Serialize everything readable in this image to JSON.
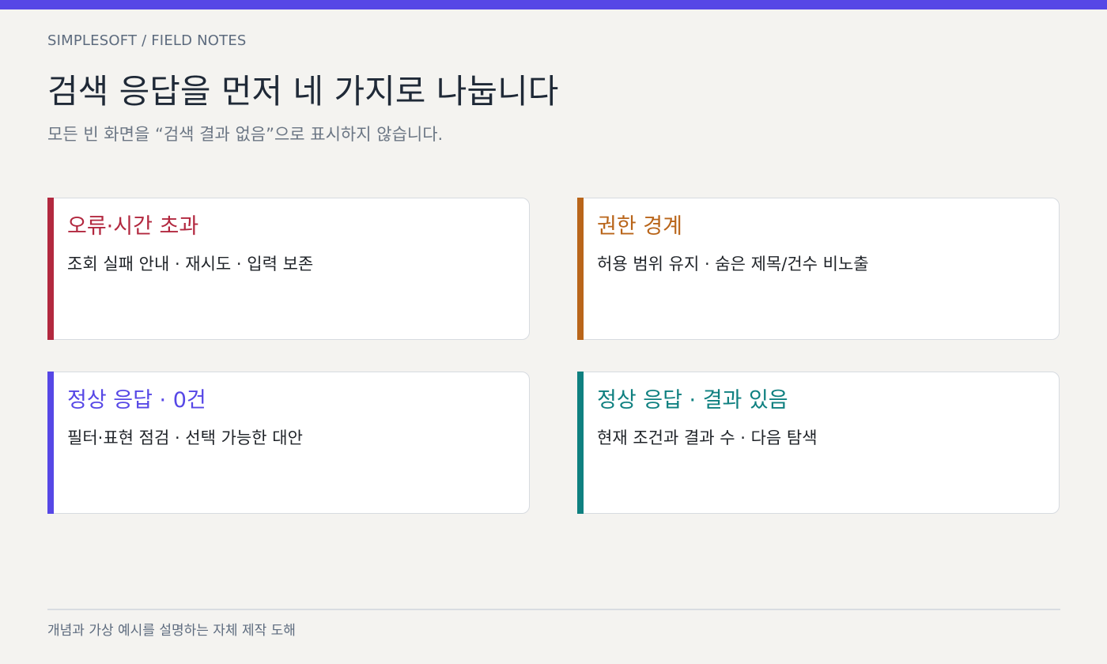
{
  "colors": {
    "accent_bar": "#5647e6",
    "error": "#b2283f",
    "permission": "#b9651a",
    "empty": "#5647e6",
    "results": "#0f8080"
  },
  "header": {
    "breadcrumb": "SIMPLESOFT / FIELD NOTES",
    "title": "검색 응답을 먼저 네 가지로 나눕니다",
    "subtitle": "모든 빈 화면을 “검색 결과 없음”으로 표시하지 않습니다."
  },
  "cards": [
    {
      "title": "오류·시간 초과",
      "description": "조회 실패 안내 · 재시도 · 입력 보존",
      "color": "#b2283f"
    },
    {
      "title": "권한 경계",
      "description": "허용 범위 유지 · 숨은 제목/건수 비노출",
      "color": "#b9651a"
    },
    {
      "title": "정상 응답 · 0건",
      "description": "필터·표현 점검 · 선택 가능한 대안",
      "color": "#5647e6"
    },
    {
      "title": "정상 응답 · 결과 있음",
      "description": "현재 조건과 결과 수 · 다음 탐색",
      "color": "#0f8080"
    }
  ],
  "footer": {
    "note": "개념과 가상 예시를 설명하는 자체 제작 도해"
  }
}
